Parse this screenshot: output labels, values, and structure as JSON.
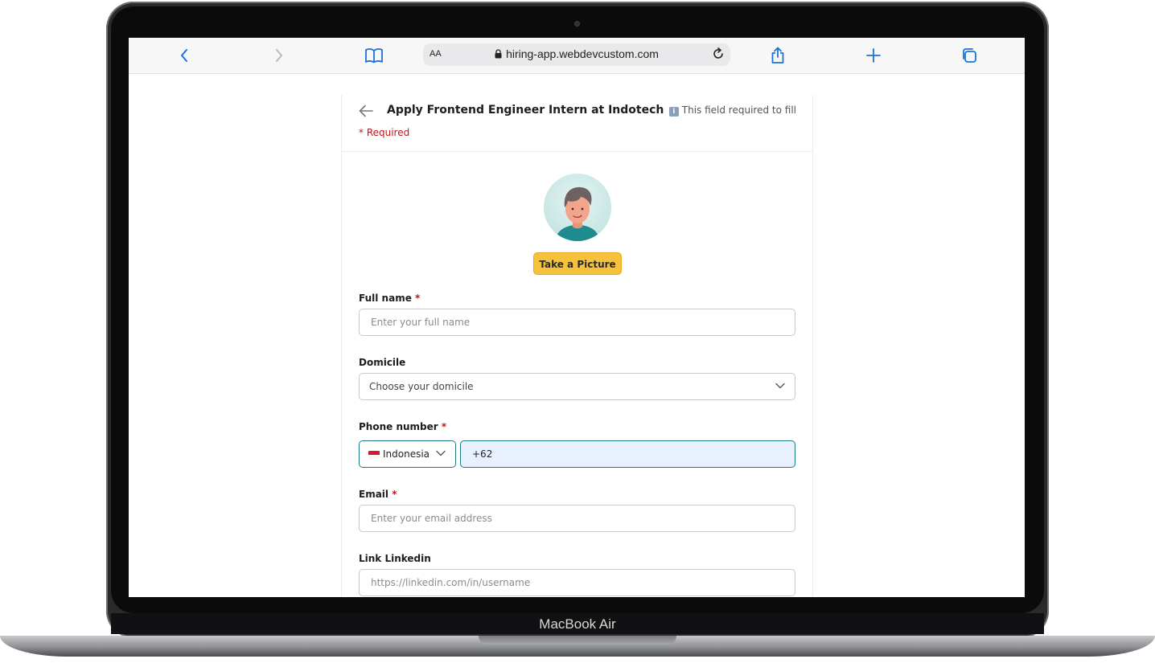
{
  "device": {
    "label": "MacBook Air"
  },
  "browser": {
    "text_size_label": "AA",
    "url": "hiring-app.webdevcustom.com"
  },
  "form": {
    "title": "Apply Frontend Engineer Intern at Indotech",
    "hint": "This field required to fill",
    "required_note": "* Required",
    "take_picture_label": "Take a Picture",
    "full_name": {
      "label": "Full name",
      "required_mark": "*",
      "placeholder": "Enter your full name"
    },
    "domicile": {
      "label": "Domicile",
      "placeholder": "Choose your domicile"
    },
    "phone": {
      "label": "Phone number",
      "required_mark": "*",
      "country": "Indonesia",
      "value": "+62"
    },
    "email": {
      "label": "Email",
      "required_mark": "*",
      "placeholder": "Enter your email address"
    },
    "linkedin": {
      "label": "Link Linkedin",
      "placeholder": "https://linkedin.com/in/username"
    }
  },
  "colors": {
    "accent_button": "#f7c23b",
    "required_red": "#c0131b",
    "active_border": "#1e7b80",
    "safari_blue": "#1a73d9"
  }
}
